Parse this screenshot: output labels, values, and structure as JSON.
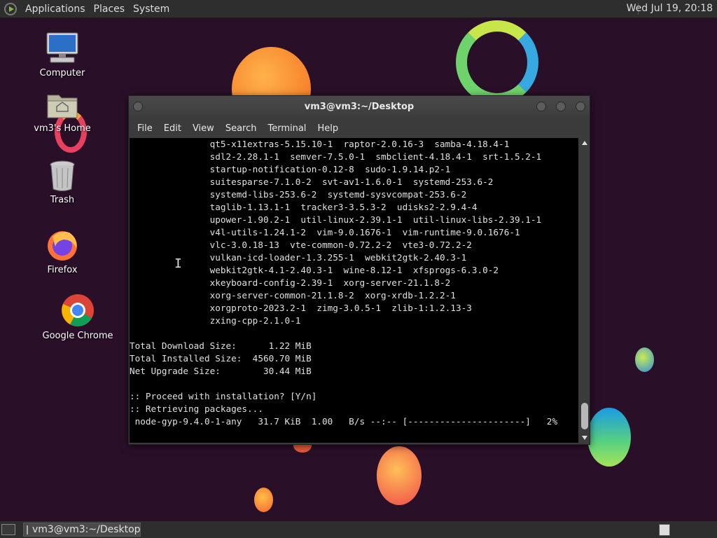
{
  "top_panel": {
    "menus": [
      "Applications",
      "Places",
      "System"
    ],
    "clock": "Wed Jul 19, 20:18"
  },
  "desktop_icons": [
    {
      "label": "Computer",
      "icon": "computer-icon"
    },
    {
      "label": "vm3's Home",
      "icon": "home-folder-icon"
    },
    {
      "label": "Trash",
      "icon": "trash-icon"
    },
    {
      "label": "Firefox",
      "icon": "firefox-icon"
    },
    {
      "label": "Google Chrome",
      "icon": "chrome-icon"
    }
  ],
  "window": {
    "title": "vm3@vm3:~/Desktop",
    "menu": [
      "File",
      "Edit",
      "View",
      "Search",
      "Terminal",
      "Help"
    ],
    "terminal_lines": [
      "               qt5-x11extras-5.15.10-1  raptor-2.0.16-3  samba-4.18.4-1",
      "               sdl2-2.28.1-1  semver-7.5.0-1  smbclient-4.18.4-1  srt-1.5.2-1",
      "               startup-notification-0.12-8  sudo-1.9.14.p2-1",
      "               suitesparse-7.1.0-2  svt-av1-1.6.0-1  systemd-253.6-2",
      "               systemd-libs-253.6-2  systemd-sysvcompat-253.6-2",
      "               taglib-1.13.1-1  tracker3-3.5.3-2  udisks2-2.9.4-4",
      "               upower-1.90.2-1  util-linux-2.39.1-1  util-linux-libs-2.39.1-1",
      "               v4l-utils-1.24.1-2  vim-9.0.1676-1  vim-runtime-9.0.1676-1",
      "               vlc-3.0.18-13  vte-common-0.72.2-2  vte3-0.72.2-2",
      "               vulkan-icd-loader-1.3.255-1  webkit2gtk-2.40.3-1",
      "               webkit2gtk-4.1-2.40.3-1  wine-8.12-1  xfsprogs-6.3.0-2",
      "               xkeyboard-config-2.39-1  xorg-server-21.1.8-2",
      "               xorg-server-common-21.1.8-2  xorg-xrdb-1.2.2-1",
      "               xorgproto-2023.2-1  zimg-3.0.5-1  zlib-1:1.2.13-3",
      "               zxing-cpp-2.1.0-1",
      "",
      "Total Download Size:      1.22 MiB",
      "Total Installed Size:  4560.70 MiB",
      "Net Upgrade Size:        30.44 MiB",
      "",
      ":: Proceed with installation? [Y/n]",
      ":: Retrieving packages...",
      " node-gyp-9.4.0-1-any   31.7 KiB  1.00   B/s --:-- [----------------------]   2%"
    ]
  },
  "taskbar": {
    "task_label": "vm3@vm3:~/Desktop"
  }
}
